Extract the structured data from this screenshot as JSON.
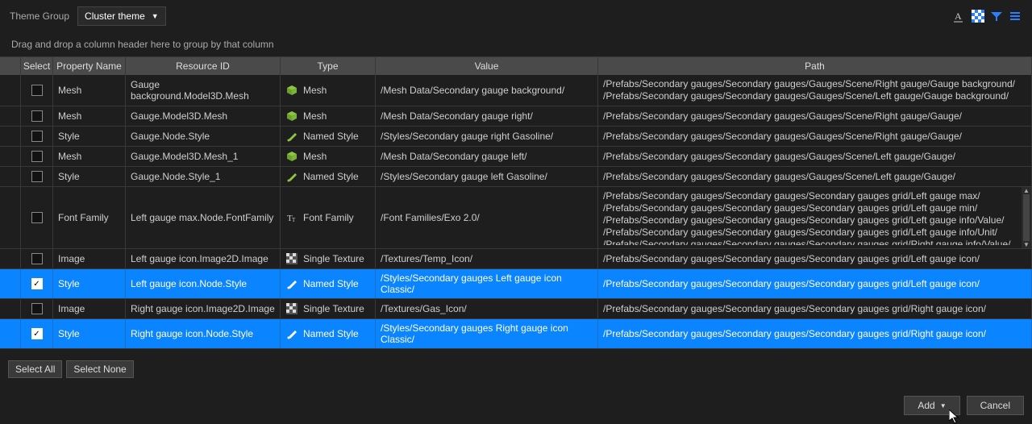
{
  "topbar": {
    "theme_group_label": "Theme Group",
    "dropdown_value": "Cluster theme"
  },
  "instruction": "Drag and drop a column header here to group by that column",
  "columns": {
    "select": "Select",
    "property": "Property Name",
    "resource": "Resource ID",
    "type": "Type",
    "value": "Value",
    "path": "Path"
  },
  "rows": [
    {
      "checked": false,
      "selected": false,
      "property": "Mesh",
      "resource": "Gauge background.Model3D.Mesh",
      "type_icon": "cube",
      "type": "Mesh",
      "value": "/Mesh Data/Secondary gauge background/",
      "paths": [
        "/Prefabs/Secondary gauges/Secondary gauges/Gauges/Scene/Right gauge/Gauge background/",
        "/Prefabs/Secondary gauges/Secondary gauges/Gauges/Scene/Left gauge/Gauge background/"
      ]
    },
    {
      "checked": false,
      "selected": false,
      "property": "Mesh",
      "resource": "Gauge.Model3D.Mesh",
      "type_icon": "cube",
      "type": "Mesh",
      "value": "/Mesh Data/Secondary gauge right/",
      "paths": [
        "/Prefabs/Secondary gauges/Secondary gauges/Gauges/Scene/Right gauge/Gauge/"
      ]
    },
    {
      "checked": false,
      "selected": false,
      "property": "Style",
      "resource": "Gauge.Node.Style",
      "type_icon": "brush",
      "type": "Named Style",
      "value": "/Styles/Secondary gauge right Gasoline/",
      "paths": [
        "/Prefabs/Secondary gauges/Secondary gauges/Gauges/Scene/Right gauge/Gauge/"
      ]
    },
    {
      "checked": false,
      "selected": false,
      "property": "Mesh",
      "resource": "Gauge.Model3D.Mesh_1",
      "type_icon": "cube",
      "type": "Mesh",
      "value": "/Mesh Data/Secondary gauge left/",
      "paths": [
        "/Prefabs/Secondary gauges/Secondary gauges/Gauges/Scene/Left gauge/Gauge/"
      ]
    },
    {
      "checked": false,
      "selected": false,
      "property": "Style",
      "resource": "Gauge.Node.Style_1",
      "type_icon": "brush",
      "type": "Named Style",
      "value": "/Styles/Secondary gauge left Gasoline/",
      "paths": [
        "/Prefabs/Secondary gauges/Secondary gauges/Gauges/Scene/Left gauge/Gauge/"
      ]
    },
    {
      "checked": false,
      "selected": false,
      "property": "Font Family",
      "resource": "Left gauge max.Node.FontFamily",
      "type_icon": "font",
      "type": "Font Family",
      "value": "/Font Families/Exo 2.0/",
      "paths": [
        "/Prefabs/Secondary gauges/Secondary gauges/Secondary gauges grid/Left gauge max/",
        "/Prefabs/Secondary gauges/Secondary gauges/Secondary gauges grid/Left gauge min/",
        "/Prefabs/Secondary gauges/Secondary gauges/Secondary gauges grid/Left gauge info/Value/",
        "/Prefabs/Secondary gauges/Secondary gauges/Secondary gauges grid/Left gauge info/Unit/",
        "/Prefabs/Secondary gauges/Secondary gauges/Secondary gauges grid/Right gauge info/Value/"
      ],
      "scrollable": true
    },
    {
      "checked": false,
      "selected": false,
      "property": "Image",
      "resource": "Left gauge icon.Image2D.Image",
      "type_icon": "texture",
      "type": "Single Texture",
      "value": "/Textures/Temp_Icon/",
      "paths": [
        "/Prefabs/Secondary gauges/Secondary gauges/Secondary gauges grid/Left gauge icon/"
      ]
    },
    {
      "checked": true,
      "selected": true,
      "property": "Style",
      "resource": "Left gauge icon.Node.Style",
      "type_icon": "brush",
      "type": "Named Style",
      "value": "/Styles/Secondary gauges Left gauge icon Classic/",
      "paths": [
        "/Prefabs/Secondary gauges/Secondary gauges/Secondary gauges grid/Left gauge icon/"
      ]
    },
    {
      "checked": false,
      "selected": false,
      "property": "Image",
      "resource": "Right gauge icon.Image2D.Image",
      "type_icon": "texture",
      "type": "Single Texture",
      "value": "/Textures/Gas_Icon/",
      "paths": [
        "/Prefabs/Secondary gauges/Secondary gauges/Secondary gauges grid/Right gauge icon/"
      ]
    },
    {
      "checked": true,
      "selected": true,
      "property": "Style",
      "resource": "Right gauge icon.Node.Style",
      "type_icon": "brush",
      "type": "Named Style",
      "value": "/Styles/Secondary gauges Right gauge icon Classic/",
      "paths": [
        "/Prefabs/Secondary gauges/Secondary gauges/Secondary gauges grid/Right gauge icon/"
      ]
    }
  ],
  "buttons": {
    "select_all": "Select All",
    "select_none": "Select None",
    "add": "Add",
    "cancel": "Cancel"
  }
}
